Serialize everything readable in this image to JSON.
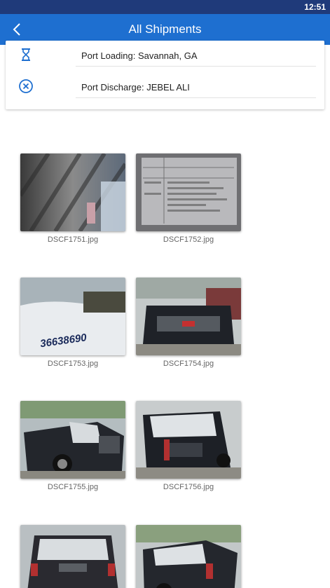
{
  "status": {
    "time": "12:51"
  },
  "header": {
    "title": "All Shipments"
  },
  "details": {
    "port_loading": "Port Loading: Savannah, GA",
    "port_discharge": "Port Discharge: JEBEL ALI"
  },
  "photos": [
    {
      "file": "DSCF1751.jpg"
    },
    {
      "file": "DSCF1752.jpg"
    },
    {
      "file": "DSCF1753.jpg",
      "container_number": "36638690"
    },
    {
      "file": "DSCF1754.jpg"
    },
    {
      "file": "DSCF1755.jpg"
    },
    {
      "file": "DSCF1756.jpg"
    },
    {
      "file": ""
    },
    {
      "file": ""
    }
  ],
  "colors": {
    "status_bar": "#1f3a7a",
    "app_bar": "#1e6fd0",
    "icon_blue": "#1e6fd0"
  }
}
